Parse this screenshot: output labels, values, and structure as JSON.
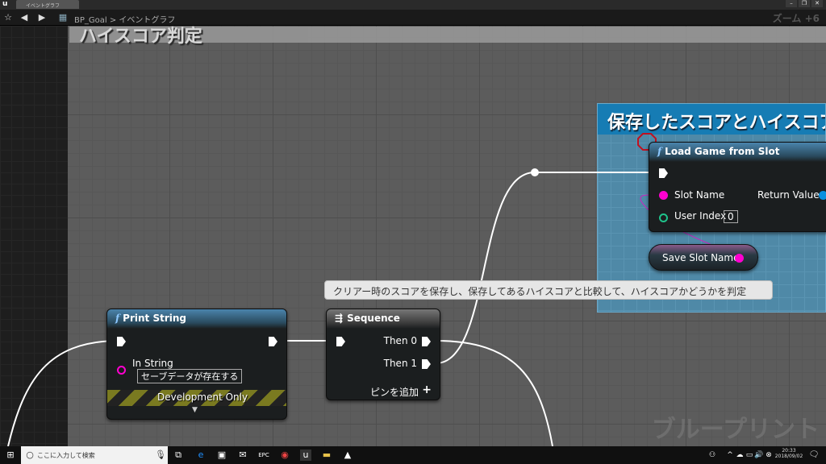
{
  "window": {
    "tab_label": "イベントグラフ",
    "controls": [
      "–",
      "❐",
      "✕"
    ]
  },
  "toolbar": {
    "breadcrumb": "BP_Goal > イベントグラフ",
    "zoom": "ズーム +6"
  },
  "comments": {
    "outer": "ハイスコア判定",
    "inner": "保存したスコアとハイスコア"
  },
  "tooltip": "クリアー時のスコアを保存し、保存してあるハイスコアと比較して、ハイスコアかどうかを判定",
  "print_string": {
    "title": "Print String",
    "in_string_label": "In String",
    "in_string_value": "セーブデータが存在する",
    "dev_only": "Development Only"
  },
  "sequence": {
    "title": "Sequence",
    "then0": "Then 0",
    "then1": "Then 1",
    "add_pin": "ピンを追加"
  },
  "load_game": {
    "title": "Load Game from Slot",
    "slot_name": "Slot Name",
    "user_index": "User Index",
    "user_index_value": "0",
    "return_value": "Return Value"
  },
  "save_slot_var": "Save Slot Name",
  "watermark": "ブループリント",
  "taskbar": {
    "search_placeholder": "ここに入力して検索",
    "time": "20:33",
    "date": "2018/09/02"
  },
  "colors": {
    "string_pin": "#ff00d0",
    "int_pin": "#1fc28a",
    "object_pin": "#0a90e0",
    "comment_blue": "#167cb4"
  }
}
